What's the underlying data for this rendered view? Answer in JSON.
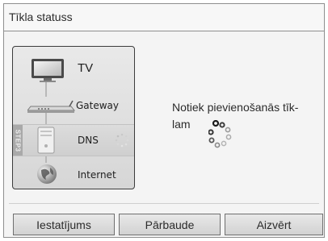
{
  "dialog": {
    "title": "Tīkla statuss",
    "status_panel": {
      "tv_label": "TV",
      "gateway_label": "Gateway",
      "dns_label": "DNS",
      "internet_label": "Internet",
      "step_tab": "STEP3"
    },
    "message": "Notiek pievienošanās tīk-\nlam",
    "buttons": {
      "settings": "Iestatījums",
      "check": "Pārbaude",
      "close": "Aizvērt"
    }
  },
  "icons": {
    "tv": "tv-icon",
    "gateway": "router-icon",
    "dns": "server-icon",
    "internet": "globe-icon",
    "spinner": "loading-spinner-icon"
  },
  "colors": {
    "border": "#8f8f8f",
    "panel_bg": "#e0e0e0",
    "button_bg": "#dcdcdc"
  }
}
